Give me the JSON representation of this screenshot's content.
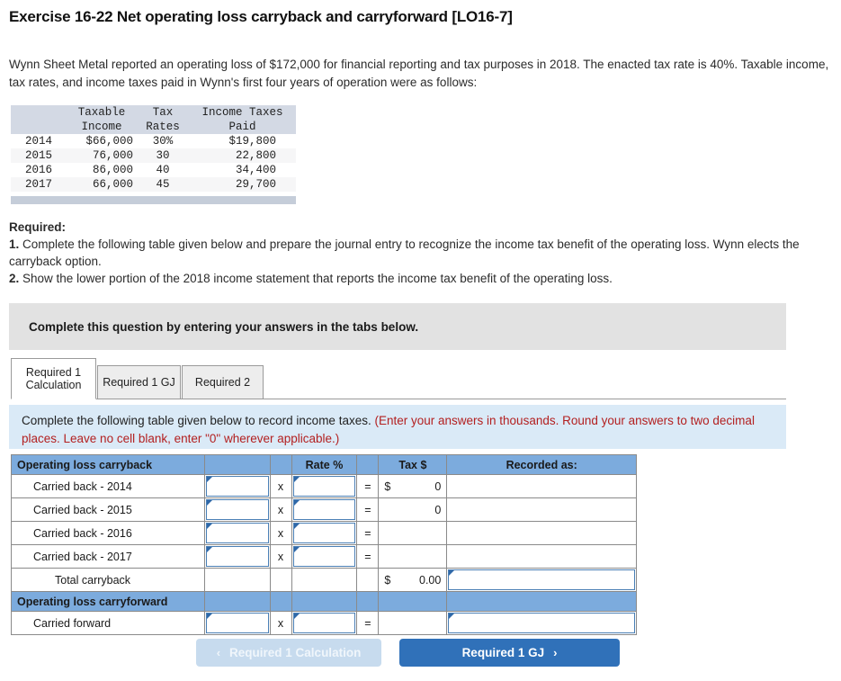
{
  "title": "Exercise 16-22 Net operating loss carryback and carryforward [LO16-7]",
  "intro": "Wynn Sheet Metal reported an operating loss of $172,000 for financial reporting and tax purposes in 2018. The enacted tax rate is 40%. Taxable income, tax rates, and income taxes paid in Wynn's first four years of operation were as follows:",
  "given_table": {
    "headers_line1": [
      "",
      "Taxable",
      "Tax",
      "Income Taxes"
    ],
    "headers_line2": [
      "",
      "Income",
      "Rates",
      "Paid"
    ],
    "rows": [
      {
        "year": "2014",
        "income": "$66,000",
        "rate": "30%",
        "paid": "$19,800"
      },
      {
        "year": "2015",
        "income": "76,000",
        "rate": "30",
        "paid": "22,800"
      },
      {
        "year": "2016",
        "income": "86,000",
        "rate": "40",
        "paid": "34,400"
      },
      {
        "year": "2017",
        "income": "66,000",
        "rate": "45",
        "paid": "29,700"
      }
    ]
  },
  "required": {
    "heading": "Required:",
    "item1_num": "1.",
    "item1": "Complete the following table given below and prepare the journal entry to recognize the income tax benefit of the operating loss. Wynn elects the carryback option.",
    "item2_num": "2.",
    "item2": "Show the lower portion of the 2018 income statement that reports the income tax benefit of the operating loss."
  },
  "grey_banner": "Complete this question by entering your answers in the tabs below.",
  "tabs": [
    {
      "label": "Required 1 Calculation",
      "active": true
    },
    {
      "label": "Required 1 GJ",
      "active": false
    },
    {
      "label": "Required 2",
      "active": false
    }
  ],
  "blue_banner": {
    "black_text": "Complete the following table given below to record income taxes.",
    "red_text": "(Enter your answers in thousands. Round your answers to two decimal places. Leave no cell blank, enter \"0\" wherever applicable.)"
  },
  "answer_table": {
    "header": {
      "label": "Operating loss carryback",
      "amount": "",
      "x": "",
      "rate": "Rate %",
      "eq": "",
      "tax": "Tax $",
      "recorded": "Recorded as:"
    },
    "section2_label": "Operating loss carryforward",
    "rows": [
      {
        "label": "Carried back - 2014",
        "amount": "",
        "x": "x",
        "rate": "",
        "eq": "=",
        "tax_dollar": "$",
        "tax_value": "0",
        "recorded": "",
        "amount_input": true,
        "rate_input": true,
        "recorded_input": false
      },
      {
        "label": "Carried back - 2015",
        "amount": "",
        "x": "x",
        "rate": "",
        "eq": "=",
        "tax_dollar": "",
        "tax_value": "0",
        "recorded": "",
        "amount_input": true,
        "rate_input": true,
        "recorded_input": false
      },
      {
        "label": "Carried back - 2016",
        "amount": "",
        "x": "x",
        "rate": "",
        "eq": "=",
        "tax_dollar": "",
        "tax_value": "",
        "recorded": "",
        "amount_input": true,
        "rate_input": true,
        "recorded_input": false
      },
      {
        "label": "Carried back - 2017",
        "amount": "",
        "x": "x",
        "rate": "",
        "eq": "=",
        "tax_dollar": "",
        "tax_value": "",
        "recorded": "",
        "amount_input": true,
        "rate_input": true,
        "recorded_input": false
      },
      {
        "label": "Total carryback",
        "amount": "",
        "x": "",
        "rate": "",
        "eq": "",
        "tax_dollar": "$",
        "tax_value": "0.00",
        "recorded": "",
        "amount_input": false,
        "rate_input": false,
        "recorded_input": true,
        "indent": 2
      },
      {
        "label": "Carried forward",
        "amount": "",
        "x": "x",
        "rate": "",
        "eq": "=",
        "tax_dollar": "",
        "tax_value": "",
        "recorded": "",
        "amount_input": true,
        "rate_input": true,
        "recorded_input": true
      }
    ]
  },
  "nav": {
    "prev_label": "Required 1 Calculation",
    "prev_chevron": "‹",
    "next_label": "Required 1 GJ",
    "next_chevron": "›"
  },
  "colors": {
    "table_header_blue": "#7cabdd",
    "banner_blue": "#daeaf7",
    "banner_grey": "#e2e2e2",
    "button_blue": "#3071b9",
    "button_disabled": "#c7dbee",
    "red_text": "#b32020",
    "given_header_grey": "#d3d9e4"
  }
}
